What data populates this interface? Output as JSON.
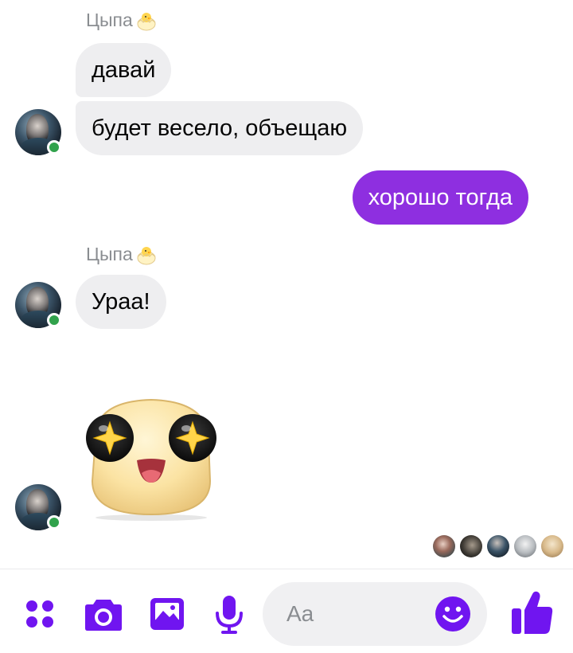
{
  "conversation": {
    "groups": [
      {
        "sender": "Цыпа",
        "sender_emoji": "chick-icon",
        "messages": [
          "давай",
          "будет весело, объещаю"
        ]
      },
      {
        "outgoing": [
          "хорошо тогда"
        ]
      },
      {
        "sender": "Цыпа",
        "sender_emoji": "chick-icon",
        "messages": [
          "Ураа!"
        ]
      },
      {
        "sticker": "starry-eyes-face-sticker"
      }
    ],
    "seen_by_count": 5
  },
  "composer": {
    "placeholder": "Aa",
    "icons": [
      "more-apps-icon",
      "camera-icon",
      "gallery-icon",
      "microphone-icon",
      "emoji-icon",
      "like-icon"
    ]
  },
  "colors": {
    "accent": "#7015f0",
    "outgoing_bubble": "#8e2fe0",
    "incoming_bubble": "#eeeef0",
    "online": "#31a24c"
  }
}
